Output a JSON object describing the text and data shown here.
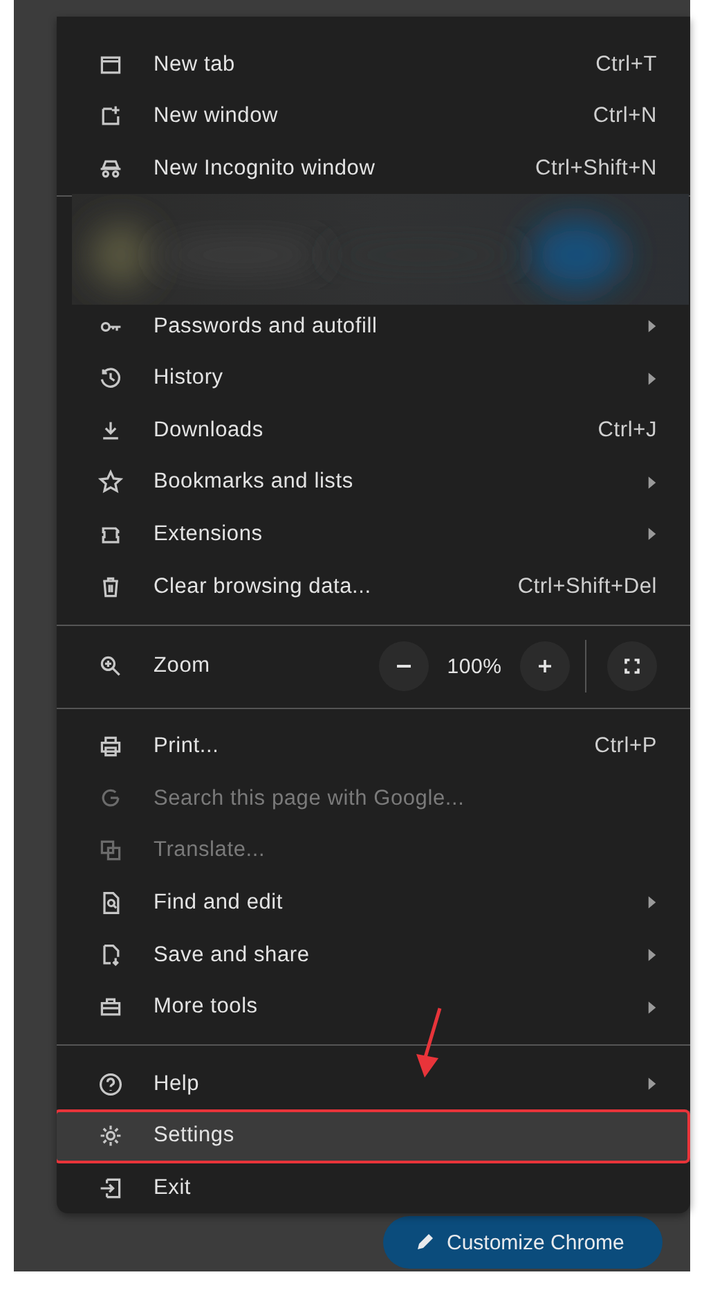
{
  "menu": {
    "entries": [
      {
        "kind": "item",
        "label": "New tab",
        "shortcut": "Ctrl+T",
        "submenu": false,
        "disabled": false,
        "selected": false,
        "annotated": false
      },
      {
        "kind": "item",
        "label": "New window",
        "shortcut": "Ctrl+N",
        "submenu": false,
        "disabled": false,
        "selected": false,
        "annotated": false
      },
      {
        "kind": "item",
        "label": "New Incognito window",
        "shortcut": "Ctrl+Shift+N",
        "submenu": false,
        "disabled": false,
        "selected": false,
        "annotated": false
      },
      {
        "kind": "profile"
      },
      {
        "kind": "item",
        "label": "Passwords and autofill",
        "submenu": true,
        "disabled": false,
        "selected": false,
        "annotated": false
      },
      {
        "kind": "item",
        "label": "History",
        "submenu": true,
        "disabled": false,
        "selected": false,
        "annotated": false
      },
      {
        "kind": "item",
        "label": "Downloads",
        "shortcut": "Ctrl+J",
        "submenu": false,
        "disabled": false,
        "selected": false,
        "annotated": false
      },
      {
        "kind": "item",
        "label": "Bookmarks and lists",
        "submenu": true,
        "disabled": false,
        "selected": false,
        "annotated": false
      },
      {
        "kind": "item",
        "label": "Extensions",
        "submenu": true,
        "disabled": false,
        "selected": false,
        "annotated": false
      },
      {
        "kind": "item",
        "label": "Clear browsing data...",
        "shortcut": "Ctrl+Shift+Del",
        "submenu": false,
        "disabled": false,
        "selected": false,
        "annotated": false
      },
      {
        "kind": "divider"
      },
      {
        "kind": "zoom",
        "label": "Zoom",
        "value": "100%"
      },
      {
        "kind": "divider"
      },
      {
        "kind": "item",
        "label": "Print...",
        "shortcut": "Ctrl+P",
        "submenu": false,
        "disabled": false,
        "selected": false,
        "annotated": false
      },
      {
        "kind": "item",
        "label": "Search this page with Google...",
        "submenu": false,
        "disabled": true,
        "selected": false,
        "annotated": false
      },
      {
        "kind": "item",
        "label": "Translate...",
        "submenu": false,
        "disabled": true,
        "selected": false,
        "annotated": false
      },
      {
        "kind": "item",
        "label": "Find and edit",
        "submenu": true,
        "disabled": false,
        "selected": false,
        "annotated": false
      },
      {
        "kind": "item",
        "label": "Save and share",
        "submenu": true,
        "disabled": false,
        "selected": false,
        "annotated": false
      },
      {
        "kind": "item",
        "label": "More tools",
        "submenu": true,
        "disabled": false,
        "selected": false,
        "annotated": false
      },
      {
        "kind": "divider"
      },
      {
        "kind": "item",
        "label": "Help",
        "submenu": true,
        "disabled": false,
        "selected": false,
        "annotated": false
      },
      {
        "kind": "item",
        "label": "Settings",
        "submenu": false,
        "disabled": false,
        "selected": true,
        "annotated": true
      },
      {
        "kind": "item",
        "label": "Exit",
        "submenu": false,
        "disabled": false,
        "selected": false,
        "annotated": false
      }
    ]
  },
  "customize_button": {
    "label": "Customize Chrome"
  }
}
